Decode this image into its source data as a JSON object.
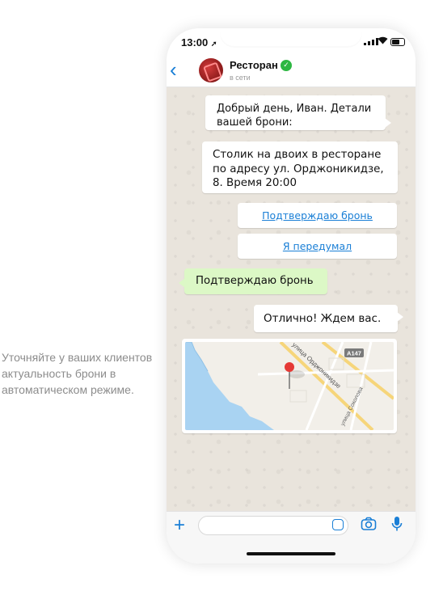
{
  "caption": "Уточняйте у ваших клиентов актуальность брони в автоматическом режиме.",
  "status_bar": {
    "time": "13:00",
    "location_glyph": "➚"
  },
  "header": {
    "back_glyph": "‹",
    "contact_name": "Ресторан",
    "verified_glyph": "✓",
    "presence": "в сети"
  },
  "messages": {
    "greeting": "Добрый день, Иван. Детали вашей брони:",
    "details": "Столик на двоих в ресторане по адресу ул. Орджоникидзе, 8. Время 20:00",
    "quick_replies": [
      "Подтверждаю бронь",
      "Я передумал"
    ],
    "user_reply": "Подтверждаю бронь",
    "response": "Отлично! Ждем вас."
  },
  "map": {
    "street_main": "улица Орджоникидзе",
    "street_side": "улица Соколова",
    "road_badge": "А147",
    "colors": {
      "water": "#a9d3f2",
      "land": "#f2efe9",
      "road": "#f6d57a",
      "pin": "#e53935"
    }
  },
  "composer": {
    "placeholder": "",
    "plus_glyph": "+"
  },
  "colors": {
    "accent": "#1a7fd6",
    "outgoing_bubble": "#dcf8c6",
    "chat_background": "#e9e4dc",
    "verified": "#2db742"
  }
}
